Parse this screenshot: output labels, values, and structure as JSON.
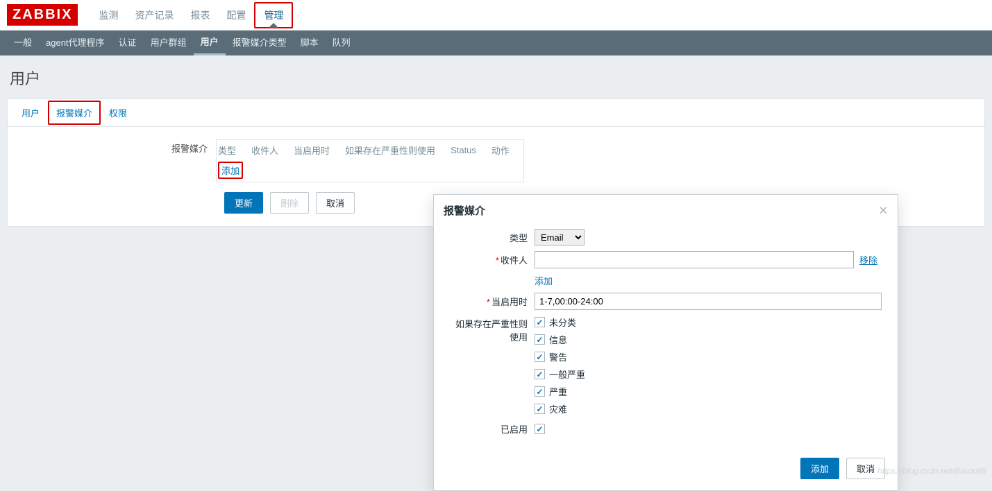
{
  "logo": "ZABBIX",
  "top_nav": {
    "items": [
      "监测",
      "资产记录",
      "报表",
      "配置",
      "管理"
    ],
    "active_index": 4
  },
  "sub_nav": {
    "items": [
      "一般",
      "agent代理程序",
      "认证",
      "用户群组",
      "用户",
      "报警媒介类型",
      "脚本",
      "队列"
    ],
    "active_index": 4
  },
  "page_title": "用户",
  "tabs": {
    "items": [
      "用户",
      "报警媒介",
      "权限"
    ],
    "active_index": 1
  },
  "form": {
    "media_label": "报警媒介",
    "table_headers": [
      "类型",
      "收件人",
      "当启用时",
      "如果存在严重性则使用",
      "Status",
      "动作"
    ],
    "add_link": "添加",
    "buttons": {
      "update": "更新",
      "delete": "删除",
      "cancel": "取消"
    }
  },
  "modal": {
    "title": "报警媒介",
    "labels": {
      "type": "类型",
      "recipient": "收件人",
      "when": "当启用时",
      "severity": "如果存在严重性则使用",
      "enabled": "已启用"
    },
    "type_value": "Email",
    "recipient_value": "",
    "remove_link": "移除",
    "add_recipient": "添加",
    "when_value": "1-7,00:00-24:00",
    "severities": [
      "未分类",
      "信息",
      "警告",
      "一般严重",
      "严重",
      "灾难"
    ],
    "enabled_checked": true,
    "footer": {
      "add": "添加",
      "cancel": "取消"
    }
  },
  "watermark": "https://blog.csdn.net/Bilson99"
}
